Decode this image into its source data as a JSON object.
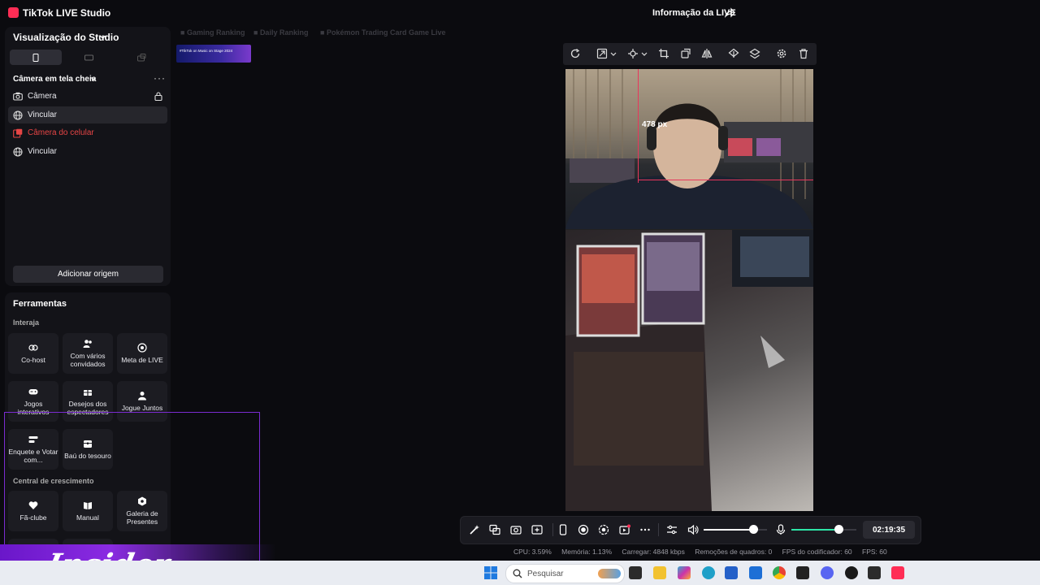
{
  "app": {
    "title": "TikTok LIVE Studio",
    "live_info": "Informação da LIVE"
  },
  "studio": {
    "title": "Visualização do Studio",
    "scene_title": "Câmera em tela cheia",
    "more": "···",
    "sources": [
      {
        "label": "Câmera",
        "icon": "camera-icon",
        "locked": true
      },
      {
        "label": "Vincular",
        "icon": "globe-icon",
        "selected": true
      },
      {
        "label": "Câmera do celular",
        "icon": "phone-camera-icon",
        "error": true
      },
      {
        "label": "Vincular",
        "icon": "globe-icon"
      }
    ],
    "add_source": "Adicionar origem"
  },
  "tools": {
    "title": "Ferramentas",
    "interact_title": "Interaja",
    "interact": [
      {
        "label": "Co-host",
        "icon": "link-icon"
      },
      {
        "label": "Com vários convidados",
        "icon": "users-icon"
      },
      {
        "label": "Meta de LIVE",
        "icon": "target-icon"
      },
      {
        "label": "Jogos interativos",
        "icon": "gamepad-icon"
      },
      {
        "label": "Desejos dos espectadores",
        "icon": "gift-icon"
      },
      {
        "label": "Jogue Juntos",
        "icon": "person-icon"
      },
      {
        "label": "Enquete e Votar com...",
        "icon": "poll-icon"
      },
      {
        "label": "Baú do tesouro",
        "icon": "chest-icon"
      }
    ],
    "growth_title": "Central de crescimento",
    "growth": [
      {
        "label": "Fã-clube",
        "icon": "heart-icon"
      },
      {
        "label": "Manual",
        "icon": "book-icon"
      },
      {
        "label": "Galeria de Presentes",
        "icon": "badge-icon"
      }
    ]
  },
  "ranking_tabs": [
    "Gaming Ranking",
    "Daily Ranking",
    "Pokémon Trading Card Game Live"
  ],
  "banner_text": "#TikTok on Music on Stage 2024",
  "preview": {
    "measure_label": "478 px"
  },
  "controls": {
    "timer": "02:19:35",
    "volume_level": 0.78,
    "mic_level": 0.72
  },
  "stats": {
    "cpu": "CPU:  3.59%",
    "memory": "Memória:  1.13%",
    "upload": "Carregar:  4848 kbps",
    "dropped": "Remoções de quadros:  0",
    "encoder_fps": "FPS do codificador:  60",
    "fps": "FPS:  60"
  },
  "watermark": "Insider",
  "taskbar": {
    "search_placeholder": "Pesquisar"
  },
  "colors": {
    "accent": "#ff2d55",
    "error": "#e64545",
    "mic_green": "#2ee6a8",
    "overlay_purple": "#7a2bd0"
  }
}
